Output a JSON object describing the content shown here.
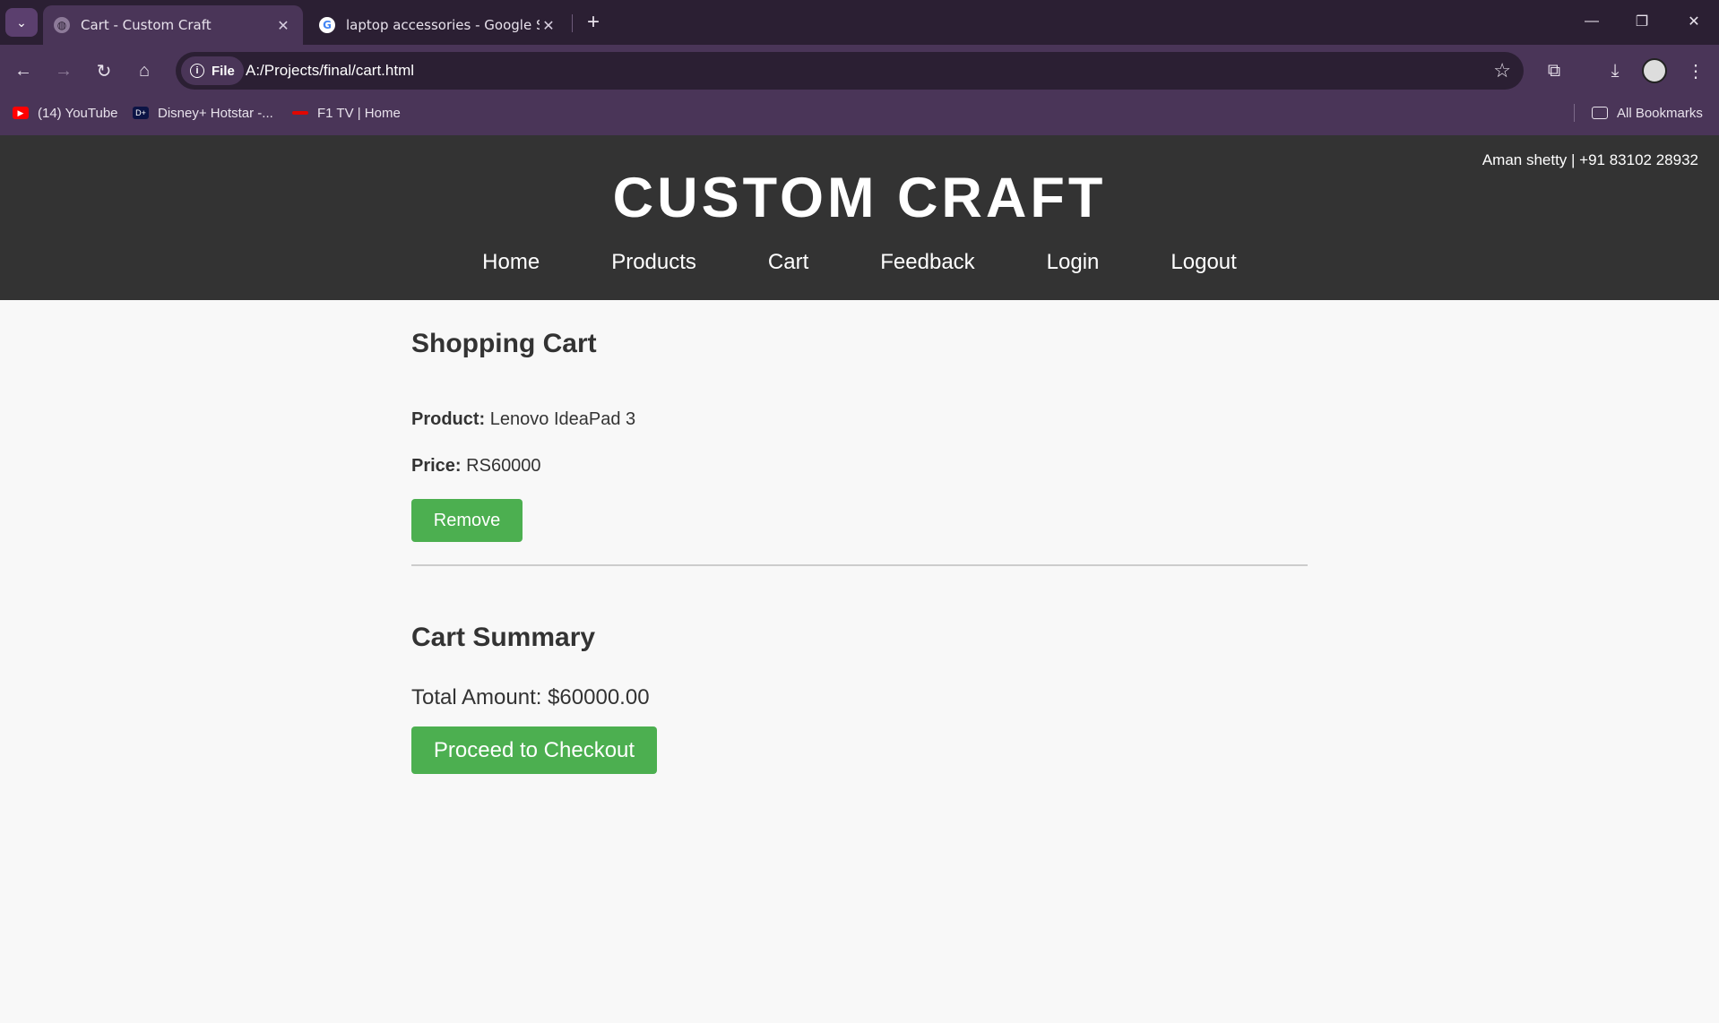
{
  "browser": {
    "tabs": [
      {
        "label": "Cart - Custom Craft",
        "active": true
      },
      {
        "label": "laptop accessories - Google Sea",
        "active": false
      }
    ],
    "address": {
      "chip_label": "File",
      "url": "A:/Projects/final/cart.html"
    },
    "bookmarks": [
      {
        "label": "(14) YouTube",
        "icon": "youtube-icon"
      },
      {
        "label": "Disney+ Hotstar -...",
        "icon": "hotstar-icon"
      },
      {
        "label": "F1 TV | Home",
        "icon": "f1-icon"
      }
    ],
    "all_bookmarks_label": "All Bookmarks"
  },
  "site": {
    "contact": "Aman shetty | +91 83102 28932",
    "brand": "CUSTOM CRAFT",
    "nav": [
      "Home",
      "Products",
      "Cart",
      "Feedback",
      "Login",
      "Logout"
    ]
  },
  "cart": {
    "title": "Shopping Cart",
    "item": {
      "product_label": "Product:",
      "product_value": "Lenovo IdeaPad 3",
      "price_label": "Price:",
      "price_value": "RS60000",
      "remove_label": "Remove"
    },
    "summary": {
      "title": "Cart Summary",
      "total_text": "Total Amount: $60000.00",
      "checkout_label": "Proceed to Checkout"
    }
  },
  "colors": {
    "header_bg": "#333333",
    "button_green": "#4caf50",
    "page_bg": "#f8f8f8",
    "browser_chrome": "#4a3558"
  }
}
